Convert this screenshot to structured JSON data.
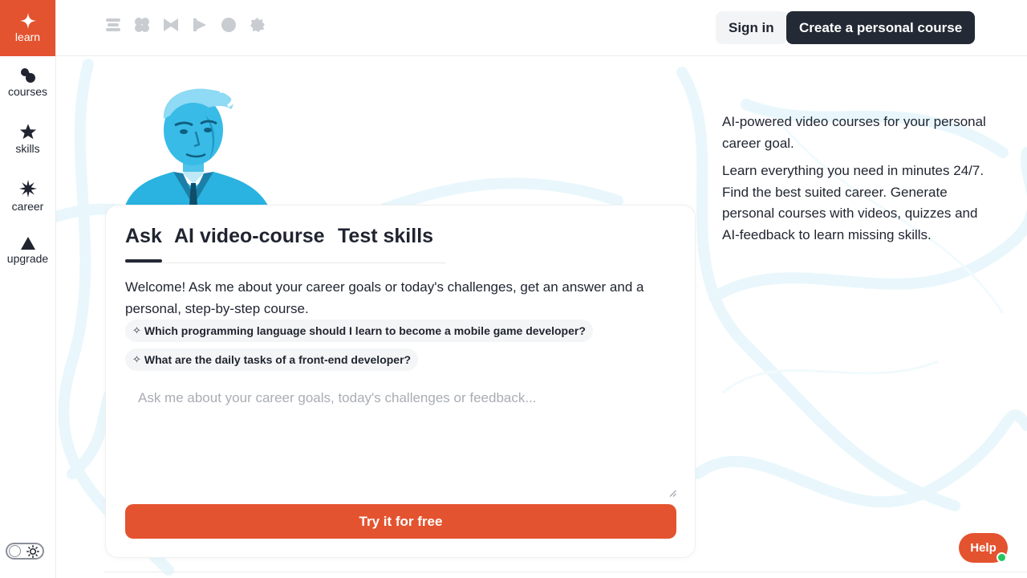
{
  "sidebar": {
    "items": [
      {
        "label": "learn",
        "icon": "sparkle-icon",
        "active": true
      },
      {
        "label": "courses",
        "icon": "courses-icon"
      },
      {
        "label": "skills",
        "icon": "star-icon"
      },
      {
        "label": "career",
        "icon": "burst-icon"
      },
      {
        "label": "upgrade",
        "icon": "triangle-up-icon"
      }
    ],
    "theme_toggle": {
      "icon": "sun-icon"
    }
  },
  "topbar": {
    "partner_logos": [
      "logo-stack-icon",
      "logo-clover-icon",
      "logo-bowtie-icon",
      "logo-flag-icon",
      "logo-circle-icon",
      "logo-gear-icon"
    ],
    "signin_label": "Sign in",
    "create_label": "Create a personal course"
  },
  "card": {
    "tabs": [
      {
        "label": "Ask",
        "active": true
      },
      {
        "label": "AI video-course"
      },
      {
        "label": "Test skills"
      }
    ],
    "welcome": "Welcome! Ask me about your career goals or today's challenges, get an answer and a personal, step-by-step course.",
    "suggestions": [
      {
        "icon": "✧",
        "text": "Which programming language should I learn to become a mobile game developer?"
      },
      {
        "icon": "✧",
        "text": "What are the daily tasks of a front-end developer?"
      }
    ],
    "input_placeholder": "Ask me about your career goals, today's challenges or feedback...",
    "cta_label": "Try it for free"
  },
  "description": {
    "line1": "AI-powered video courses for your personal career goal.",
    "line2": "Learn everything you need in minutes 24/7. Find the best suited career. Generate personal courses with videos, quizzes and AI-feedback to learn missing skills."
  },
  "help": {
    "label": "Help",
    "status": "online"
  },
  "colors": {
    "accent": "#e4532f",
    "dark": "#232a35",
    "portrait": "#2ab3e0",
    "online": "#22c55e"
  }
}
